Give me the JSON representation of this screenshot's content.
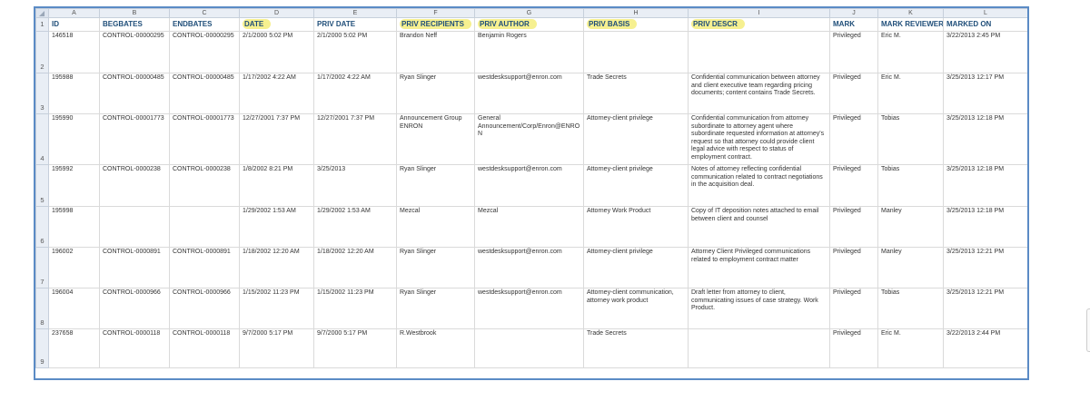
{
  "columns": [
    "A",
    "B",
    "C",
    "D",
    "E",
    "F",
    "G",
    "H",
    "I",
    "J",
    "K",
    "L"
  ],
  "headers": [
    "ID",
    "BEGBATES",
    "ENDBATES",
    "DATE",
    "PRIV DATE",
    "PRIV RECIPIENTS",
    "PRIV AUTHOR",
    "PRIV BASIS",
    "PRIV DESCR",
    "MARK",
    "MARK REVIEWER",
    "MARKED ON"
  ],
  "highlighted_headers": [
    "DATE",
    "PRIV RECIPIENTS",
    "PRIV AUTHOR",
    "PRIV BASIS",
    "PRIV DESCR"
  ],
  "highlight_color": "#f6f090",
  "header_text_color": "#1f4e79",
  "row_numbers": [
    "1",
    "2",
    "3",
    "4",
    "5",
    "6",
    "7",
    "8",
    "9"
  ],
  "rows": [
    [
      "146518",
      "CONTROL-00000295",
      "CONTROL-00000295",
      "2/1/2000 5:02 PM",
      "2/1/2000 5:02 PM",
      "Brandon Neff",
      "Benjamin Rogers",
      "",
      "",
      "Privileged",
      "Eric M.",
      "3/22/2013 2:45 PM"
    ],
    [
      "195988",
      "CONTROL-00000485",
      "CONTROL-00000485",
      "1/17/2002 4:22 AM",
      "1/17/2002 4:22 AM",
      "Ryan Slinger",
      "westdesksupport@enron.com",
      "Trade Secrets",
      "Confidential communication between attorney and client executive team regarding pricing documents; content contains Trade Secrets.",
      "Privileged",
      "Eric M.",
      "3/25/2013 12:17 PM"
    ],
    [
      "195990",
      "CONTROL-00001773",
      "CONTROL-00001773",
      "12/27/2001 7:37 PM",
      "12/27/2001 7:37 PM",
      "Announcement Group ENRON",
      "General Announcement/Corp/Enron@ENRON",
      "Attorney-client privilege",
      "Confidential communication from attorney subordinate to attorney agent where subordinate requested information at attorney's request so that attorney could provide client legal advice with respect to status of employment contract.",
      "Privileged",
      "Tobias",
      "3/25/2013 12:18 PM"
    ],
    [
      "195992",
      "CONTROL-0000238",
      "CONTROL-0000238",
      "1/8/2002 8:21 PM",
      "3/25/2013",
      "Ryan Slinger",
      "westdesksupport@enron.com",
      "Attorney-client privilege",
      "Notes of attorney reflecting confidential communication related to contract negotiations in the acquisition deal.",
      "Privileged",
      "Tobias",
      "3/25/2013 12:18 PM"
    ],
    [
      "195998",
      "",
      "",
      "1/29/2002 1:53 AM",
      "1/29/2002 1:53 AM",
      "Mezcal",
      "Mezcal",
      "Attorney Work Product",
      "Copy of IT deposition notes attached to email between client and counsel",
      "Privileged",
      "Manley",
      "3/25/2013 12:18 PM"
    ],
    [
      "196002",
      "CONTROL-0000891",
      "CONTROL-0000891",
      "1/18/2002 12:20 AM",
      "1/18/2002 12:20 AM",
      "Ryan Slinger",
      "westdesksupport@enron.com",
      "Attorney-client privilege",
      "Attorney Client Privileged communications related to employment contract matter",
      "Privileged",
      "Manley",
      "3/25/2013 12:21 PM"
    ],
    [
      "196004",
      "CONTROL-0000966",
      "CONTROL-0000966",
      "1/15/2002 11:23 PM",
      "1/15/2002 11:23 PM",
      "Ryan Slinger",
      "westdesksupport@enron.com",
      "Attorney-client communication, attorney work product",
      "Draft letter from attorney to client, communicating issues of case strategy. Work Product.",
      "Privileged",
      "Tobias",
      "3/25/2013 12:21 PM"
    ],
    [
      "237658",
      "CONTROL-0000118",
      "CONTROL-0000118",
      "9/7/2000 5:17 PM",
      "9/7/2000 5:17 PM",
      "R.Westbrook",
      "",
      "Trade Secrets",
      "",
      "Privileged",
      "Eric M.",
      "3/22/2013 2:44 PM"
    ]
  ]
}
